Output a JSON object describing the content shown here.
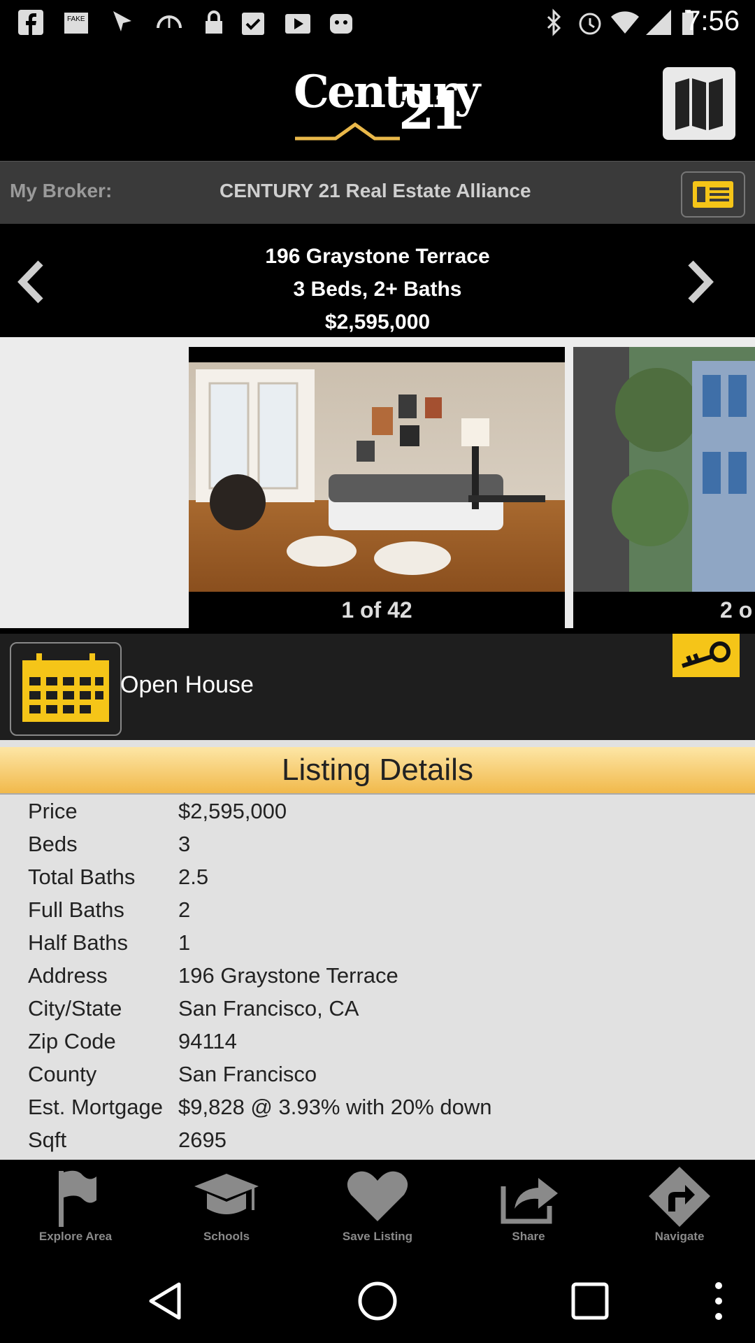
{
  "status_bar": {
    "time": "7:56",
    "icons": [
      "facebook-icon",
      "fake-gps-icon",
      "cursor-icon",
      "speedometer-icon",
      "lock-icon",
      "clipboard-icon",
      "play-store-icon",
      "android-icon",
      "bluetooth-icon",
      "alarm-icon",
      "wifi-icon",
      "signal-icon",
      "battery-icon"
    ]
  },
  "header": {
    "logo_word": "Century",
    "logo_number": "21",
    "map_icon": "map-icon"
  },
  "broker": {
    "label": "My Broker:",
    "name": "CENTURY 21 Real Estate Alliance",
    "contact_icon": "contact-card-icon"
  },
  "listing": {
    "address": "196 Graystone Terrace",
    "beds_baths": "3 Beds, 2+ Baths",
    "price": "$2,595,000"
  },
  "gallery": {
    "photo1_caption": "1 of 42",
    "photo2_caption": "2 o"
  },
  "open_house": {
    "label": "Open House",
    "calendar_icon": "calendar-icon",
    "key_icon": "key-icon"
  },
  "details": {
    "title": "Listing Details",
    "rows": [
      {
        "key": "Price",
        "value": "$2,595,000"
      },
      {
        "key": "Beds",
        "value": "3"
      },
      {
        "key": "Total Baths",
        "value": "2.5"
      },
      {
        "key": "Full Baths",
        "value": "2"
      },
      {
        "key": "Half Baths",
        "value": "1"
      },
      {
        "key": "Address",
        "value": "196 Graystone Terrace"
      },
      {
        "key": "City/State",
        "value": "San Francisco, CA"
      },
      {
        "key": "Zip Code",
        "value": "94114"
      },
      {
        "key": "County",
        "value": "San Francisco"
      },
      {
        "key": "Est. Mortgage",
        "value": "$9,828 @ 3.93% with 20% down"
      },
      {
        "key": "Sqft",
        "value": "2695"
      }
    ]
  },
  "toolbar": {
    "items": [
      {
        "label": "Explore Area",
        "icon": "flag-icon"
      },
      {
        "label": "Schools",
        "icon": "graduation-cap-icon"
      },
      {
        "label": "Save Listing",
        "icon": "heart-icon"
      },
      {
        "label": "Share",
        "icon": "share-icon"
      },
      {
        "label": "Navigate",
        "icon": "navigate-arrow-icon"
      }
    ]
  },
  "colors": {
    "accent_yellow": "#f5c518",
    "details_header": "#f1b94b",
    "toolbar_icon": "#8a8a8a"
  }
}
